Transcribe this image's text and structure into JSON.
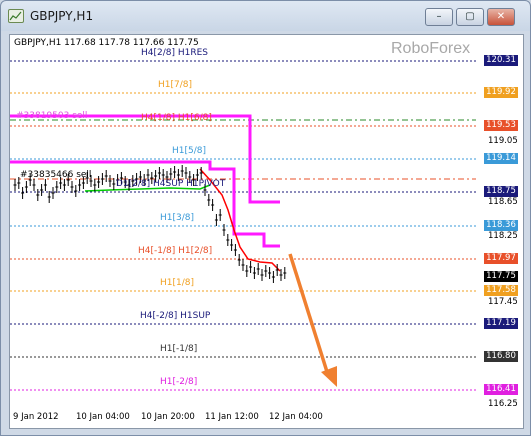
{
  "window": {
    "title": "GBPJPY,H1",
    "min_label": "–",
    "max_label": "▢",
    "close_label": "✕"
  },
  "chart": {
    "symbol_info": "GBPJPY,H1  117.68 117.78 117.66 117.75",
    "brand": "RoboForex",
    "order_labels": [
      "#33819503 sell",
      "#33835466 sell"
    ],
    "price_ticks": [
      "119.05",
      "118.65",
      "118.25",
      "117.45",
      "116.25"
    ],
    "time_ticks": [
      "9 Jan 2012",
      "10 Jan 04:00",
      "10 Jan 20:00",
      "11 Jan 12:00",
      "12 Jan 04:00"
    ],
    "levels": [
      {
        "label": "H4[2/8] H1RES",
        "tag": "120.31",
        "color": "#1a1a7a",
        "tag_bg": "#1a1a7a"
      },
      {
        "label": "H1[7/8]",
        "tag": "119.92",
        "color": "#f0a020",
        "tag_bg": "#f0a020"
      },
      {
        "label": "H4[1/8] H1[6/8]",
        "tag": "119.53",
        "color": "#e8502a",
        "tag_bg": "#e8502a"
      },
      {
        "label": "H1[5/8]",
        "tag": "119.14",
        "color": "#3a9ad8",
        "tag_bg": "#3a9ad8"
      },
      {
        "label": "D1[2/8] H4SUP H1PIVOT",
        "tag": "118.75",
        "color": "#1a1a7a",
        "tag_bg": "#1a1a7a"
      },
      {
        "label": "H1[3/8]",
        "tag": "118.36",
        "color": "#3a9ad8",
        "tag_bg": "#3a9ad8"
      },
      {
        "label": "H4[-1/8] H1[2/8]",
        "tag": "117.97",
        "color": "#e8502a",
        "tag_bg": "#e8502a"
      },
      {
        "label": "",
        "tag": "117.75",
        "color": "#000000",
        "tag_bg": "#000000"
      },
      {
        "label": "H1[1/8]",
        "tag": "117.58",
        "color": "#f0a020",
        "tag_bg": "#f0a020"
      },
      {
        "label": "H4[-2/8] H1SUP",
        "tag": "117.19",
        "color": "#1a1a7a",
        "tag_bg": "#1a1a7a"
      },
      {
        "label": "H1[-1/8]",
        "tag": "116.80",
        "color": "#333333",
        "tag_bg": "#333333"
      },
      {
        "label": "H1[-2/8]",
        "tag": "116.41",
        "color": "#e020e0",
        "tag_bg": "#e020e0"
      }
    ],
    "colors": {
      "magenta": "#ff19ff",
      "red": "#ff0000",
      "green": "#00cc00",
      "arrow": "#f08030"
    }
  }
}
